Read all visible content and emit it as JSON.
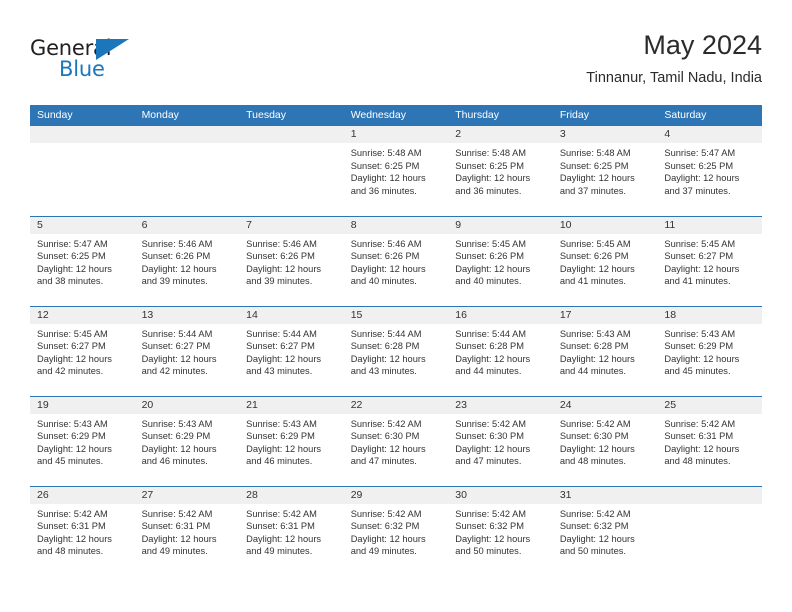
{
  "logo": {
    "word_dark": "General",
    "word_blue": "Blue",
    "triangle_icon": "blue-triangle-icon"
  },
  "header": {
    "title": "May 2024",
    "subtitle": "Tinnanur, Tamil Nadu, India"
  },
  "colors": {
    "header_blue": "#2E75B6",
    "logo_blue": "#1B76BC",
    "daynum_band": "#F0F0F0",
    "text": "#333333"
  },
  "weekdays": [
    "Sunday",
    "Monday",
    "Tuesday",
    "Wednesday",
    "Thursday",
    "Friday",
    "Saturday"
  ],
  "weeks": [
    [
      {
        "day": "",
        "empty": true
      },
      {
        "day": "",
        "empty": true
      },
      {
        "day": "",
        "empty": true
      },
      {
        "day": "1",
        "sunrise": "Sunrise: 5:48 AM",
        "sunset": "Sunset: 6:25 PM",
        "daylight_1": "Daylight: 12 hours",
        "daylight_2": "and 36 minutes."
      },
      {
        "day": "2",
        "sunrise": "Sunrise: 5:48 AM",
        "sunset": "Sunset: 6:25 PM",
        "daylight_1": "Daylight: 12 hours",
        "daylight_2": "and 36 minutes."
      },
      {
        "day": "3",
        "sunrise": "Sunrise: 5:48 AM",
        "sunset": "Sunset: 6:25 PM",
        "daylight_1": "Daylight: 12 hours",
        "daylight_2": "and 37 minutes."
      },
      {
        "day": "4",
        "sunrise": "Sunrise: 5:47 AM",
        "sunset": "Sunset: 6:25 PM",
        "daylight_1": "Daylight: 12 hours",
        "daylight_2": "and 37 minutes."
      }
    ],
    [
      {
        "day": "5",
        "sunrise": "Sunrise: 5:47 AM",
        "sunset": "Sunset: 6:25 PM",
        "daylight_1": "Daylight: 12 hours",
        "daylight_2": "and 38 minutes."
      },
      {
        "day": "6",
        "sunrise": "Sunrise: 5:46 AM",
        "sunset": "Sunset: 6:26 PM",
        "daylight_1": "Daylight: 12 hours",
        "daylight_2": "and 39 minutes."
      },
      {
        "day": "7",
        "sunrise": "Sunrise: 5:46 AM",
        "sunset": "Sunset: 6:26 PM",
        "daylight_1": "Daylight: 12 hours",
        "daylight_2": "and 39 minutes."
      },
      {
        "day": "8",
        "sunrise": "Sunrise: 5:46 AM",
        "sunset": "Sunset: 6:26 PM",
        "daylight_1": "Daylight: 12 hours",
        "daylight_2": "and 40 minutes."
      },
      {
        "day": "9",
        "sunrise": "Sunrise: 5:45 AM",
        "sunset": "Sunset: 6:26 PM",
        "daylight_1": "Daylight: 12 hours",
        "daylight_2": "and 40 minutes."
      },
      {
        "day": "10",
        "sunrise": "Sunrise: 5:45 AM",
        "sunset": "Sunset: 6:26 PM",
        "daylight_1": "Daylight: 12 hours",
        "daylight_2": "and 41 minutes."
      },
      {
        "day": "11",
        "sunrise": "Sunrise: 5:45 AM",
        "sunset": "Sunset: 6:27 PM",
        "daylight_1": "Daylight: 12 hours",
        "daylight_2": "and 41 minutes."
      }
    ],
    [
      {
        "day": "12",
        "sunrise": "Sunrise: 5:45 AM",
        "sunset": "Sunset: 6:27 PM",
        "daylight_1": "Daylight: 12 hours",
        "daylight_2": "and 42 minutes."
      },
      {
        "day": "13",
        "sunrise": "Sunrise: 5:44 AM",
        "sunset": "Sunset: 6:27 PM",
        "daylight_1": "Daylight: 12 hours",
        "daylight_2": "and 42 minutes."
      },
      {
        "day": "14",
        "sunrise": "Sunrise: 5:44 AM",
        "sunset": "Sunset: 6:27 PM",
        "daylight_1": "Daylight: 12 hours",
        "daylight_2": "and 43 minutes."
      },
      {
        "day": "15",
        "sunrise": "Sunrise: 5:44 AM",
        "sunset": "Sunset: 6:28 PM",
        "daylight_1": "Daylight: 12 hours",
        "daylight_2": "and 43 minutes."
      },
      {
        "day": "16",
        "sunrise": "Sunrise: 5:44 AM",
        "sunset": "Sunset: 6:28 PM",
        "daylight_1": "Daylight: 12 hours",
        "daylight_2": "and 44 minutes."
      },
      {
        "day": "17",
        "sunrise": "Sunrise: 5:43 AM",
        "sunset": "Sunset: 6:28 PM",
        "daylight_1": "Daylight: 12 hours",
        "daylight_2": "and 44 minutes."
      },
      {
        "day": "18",
        "sunrise": "Sunrise: 5:43 AM",
        "sunset": "Sunset: 6:29 PM",
        "daylight_1": "Daylight: 12 hours",
        "daylight_2": "and 45 minutes."
      }
    ],
    [
      {
        "day": "19",
        "sunrise": "Sunrise: 5:43 AM",
        "sunset": "Sunset: 6:29 PM",
        "daylight_1": "Daylight: 12 hours",
        "daylight_2": "and 45 minutes."
      },
      {
        "day": "20",
        "sunrise": "Sunrise: 5:43 AM",
        "sunset": "Sunset: 6:29 PM",
        "daylight_1": "Daylight: 12 hours",
        "daylight_2": "and 46 minutes."
      },
      {
        "day": "21",
        "sunrise": "Sunrise: 5:43 AM",
        "sunset": "Sunset: 6:29 PM",
        "daylight_1": "Daylight: 12 hours",
        "daylight_2": "and 46 minutes."
      },
      {
        "day": "22",
        "sunrise": "Sunrise: 5:42 AM",
        "sunset": "Sunset: 6:30 PM",
        "daylight_1": "Daylight: 12 hours",
        "daylight_2": "and 47 minutes."
      },
      {
        "day": "23",
        "sunrise": "Sunrise: 5:42 AM",
        "sunset": "Sunset: 6:30 PM",
        "daylight_1": "Daylight: 12 hours",
        "daylight_2": "and 47 minutes."
      },
      {
        "day": "24",
        "sunrise": "Sunrise: 5:42 AM",
        "sunset": "Sunset: 6:30 PM",
        "daylight_1": "Daylight: 12 hours",
        "daylight_2": "and 48 minutes."
      },
      {
        "day": "25",
        "sunrise": "Sunrise: 5:42 AM",
        "sunset": "Sunset: 6:31 PM",
        "daylight_1": "Daylight: 12 hours",
        "daylight_2": "and 48 minutes."
      }
    ],
    [
      {
        "day": "26",
        "sunrise": "Sunrise: 5:42 AM",
        "sunset": "Sunset: 6:31 PM",
        "daylight_1": "Daylight: 12 hours",
        "daylight_2": "and 48 minutes."
      },
      {
        "day": "27",
        "sunrise": "Sunrise: 5:42 AM",
        "sunset": "Sunset: 6:31 PM",
        "daylight_1": "Daylight: 12 hours",
        "daylight_2": "and 49 minutes."
      },
      {
        "day": "28",
        "sunrise": "Sunrise: 5:42 AM",
        "sunset": "Sunset: 6:31 PM",
        "daylight_1": "Daylight: 12 hours",
        "daylight_2": "and 49 minutes."
      },
      {
        "day": "29",
        "sunrise": "Sunrise: 5:42 AM",
        "sunset": "Sunset: 6:32 PM",
        "daylight_1": "Daylight: 12 hours",
        "daylight_2": "and 49 minutes."
      },
      {
        "day": "30",
        "sunrise": "Sunrise: 5:42 AM",
        "sunset": "Sunset: 6:32 PM",
        "daylight_1": "Daylight: 12 hours",
        "daylight_2": "and 50 minutes."
      },
      {
        "day": "31",
        "sunrise": "Sunrise: 5:42 AM",
        "sunset": "Sunset: 6:32 PM",
        "daylight_1": "Daylight: 12 hours",
        "daylight_2": "and 50 minutes."
      },
      {
        "day": "",
        "empty": true
      }
    ]
  ]
}
